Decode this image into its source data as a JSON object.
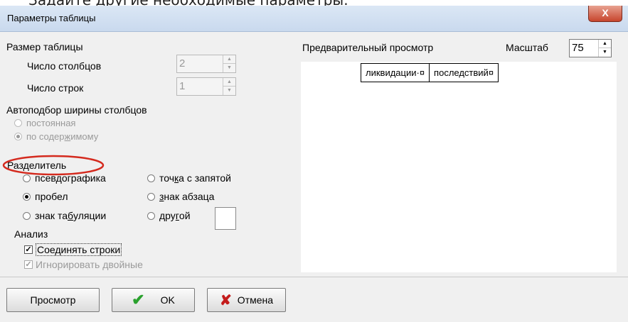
{
  "background_text": "Задайте  другие  необходимые параметры.",
  "window": {
    "title": "Параметры таблицы",
    "close_label": "X"
  },
  "table_size": {
    "title": "Размер таблицы",
    "columns_label": "Число столбцов",
    "columns_value": "2",
    "rows_label": "Число строк",
    "rows_value": "1"
  },
  "autofit": {
    "title": "Автоподбор ширины столбцов",
    "options": [
      {
        "label": "постоянная",
        "selected": false,
        "disabled": true
      },
      {
        "label_pre": "по содер",
        "label_ul": "ж",
        "label_post": "имому",
        "selected": true,
        "disabled": true
      }
    ]
  },
  "separator": {
    "title": "Разделитель",
    "options": {
      "pseudographics": "псевдографика",
      "space": "пробел",
      "tab_pre": "знак та",
      "tab_ul": "б",
      "tab_post": "уляции",
      "semicolon_pre": "точ",
      "semicolon_ul": "к",
      "semicolon_post": "а с запятой",
      "paragraph_ul": "з",
      "paragraph_post": "нак абзаца",
      "other_pre": "дру",
      "other_ul": "г",
      "other_post": "ой"
    },
    "selected": "пробел"
  },
  "analysis": {
    "title": "Анализ",
    "join_rows": "Соединять строки",
    "ignore_double": "Игнорировать двойные",
    "join_checked": true,
    "ignore_checked": true
  },
  "preview": {
    "label": "Предварительный просмотр",
    "zoom_label": "Масштаб",
    "zoom_value": "75",
    "cells": [
      "ликвидации·¤",
      "последствий¤"
    ]
  },
  "buttons": {
    "preview": "Просмотр",
    "ok": "OK",
    "cancel": "Отмена"
  },
  "colors": {
    "highlight_ellipse": "#d42a1e",
    "ok_icon": "#2aa12e",
    "cancel_icon": "#c41c1c",
    "close_button": "#c7452d"
  },
  "icons": {
    "ok": "check-icon",
    "cancel": "x-icon",
    "close": "close-icon"
  }
}
